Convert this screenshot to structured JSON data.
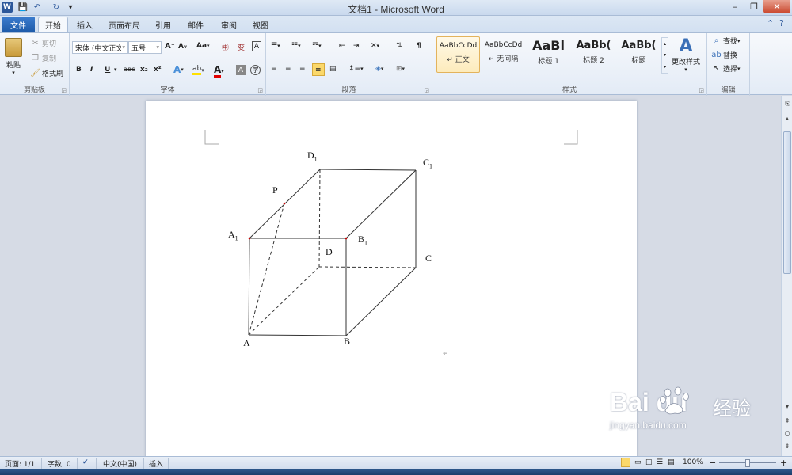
{
  "window": {
    "title": "文档1 - Microsoft Word",
    "minimize_glyph": "–",
    "maximize_glyph": "❐",
    "close_glyph": "✕"
  },
  "quick_access": {
    "app_icon": "W",
    "save_icon": "💾",
    "undo_icon": "↶",
    "redo_icon": "↻",
    "customize_icon": "▾"
  },
  "tabs": [
    {
      "label": "文件"
    },
    {
      "label": "开始"
    },
    {
      "label": "插入"
    },
    {
      "label": "页面布局"
    },
    {
      "label": "引用"
    },
    {
      "label": "邮件"
    },
    {
      "label": "审阅"
    },
    {
      "label": "视图"
    }
  ],
  "ribbon": {
    "clipboard": {
      "group_label": "剪贴板",
      "paste": "粘贴",
      "cut": "剪切",
      "copy": "复制",
      "format_painter": "格式刷"
    },
    "font": {
      "group_label": "字体",
      "font_name": "宋体 (中文正文)",
      "font_size": "五号",
      "bold": "B",
      "italic": "I",
      "underline": "U",
      "strikethrough": "abc",
      "subscript": "x₂",
      "superscript": "x²",
      "grow": "A",
      "shrink": "A",
      "change_case": "Aa",
      "clear_format": "A"
    },
    "paragraph": {
      "group_label": "段落"
    },
    "styles": {
      "group_label": "样式",
      "items": [
        {
          "sample": "AaBbCcDd",
          "name": "↵ 正文"
        },
        {
          "sample": "AaBbCcDd",
          "name": "↵ 无间隔"
        },
        {
          "sample": "AaBl",
          "name": "标题 1"
        },
        {
          "sample": "AaBb(",
          "name": "标题 2"
        },
        {
          "sample": "AaBb(",
          "name": "标题"
        }
      ],
      "change_styles": "更改样式"
    },
    "editing": {
      "group_label": "编辑",
      "find": "查找",
      "replace": "替换",
      "select": "选择"
    }
  },
  "figure": {
    "labels": {
      "A": "A",
      "B": "B",
      "C": "C",
      "D": "D",
      "A1": "A",
      "A1_sub": "1",
      "B1": "B",
      "B1_sub": "1",
      "C1": "C",
      "C1_sub": "1",
      "D1": "D",
      "D1_sub": "1",
      "P": "P"
    },
    "point_color": "#cc0000",
    "paragraph_mark": "↵"
  },
  "statusbar": {
    "page": "页面: 1/1",
    "words": "字数: 0",
    "language": "中文(中国)",
    "insert_mode": "插入",
    "zoom": "100%",
    "zoom_out": "−",
    "zoom_in": "+"
  },
  "watermark": {
    "brand": "Bai  du",
    "chinese": "经验",
    "url": "jingyan.baidu.com"
  },
  "colors": {
    "accent": "#2b579a",
    "file_tab": "#1d5aa8",
    "style_highlight": "#fdebbc"
  }
}
